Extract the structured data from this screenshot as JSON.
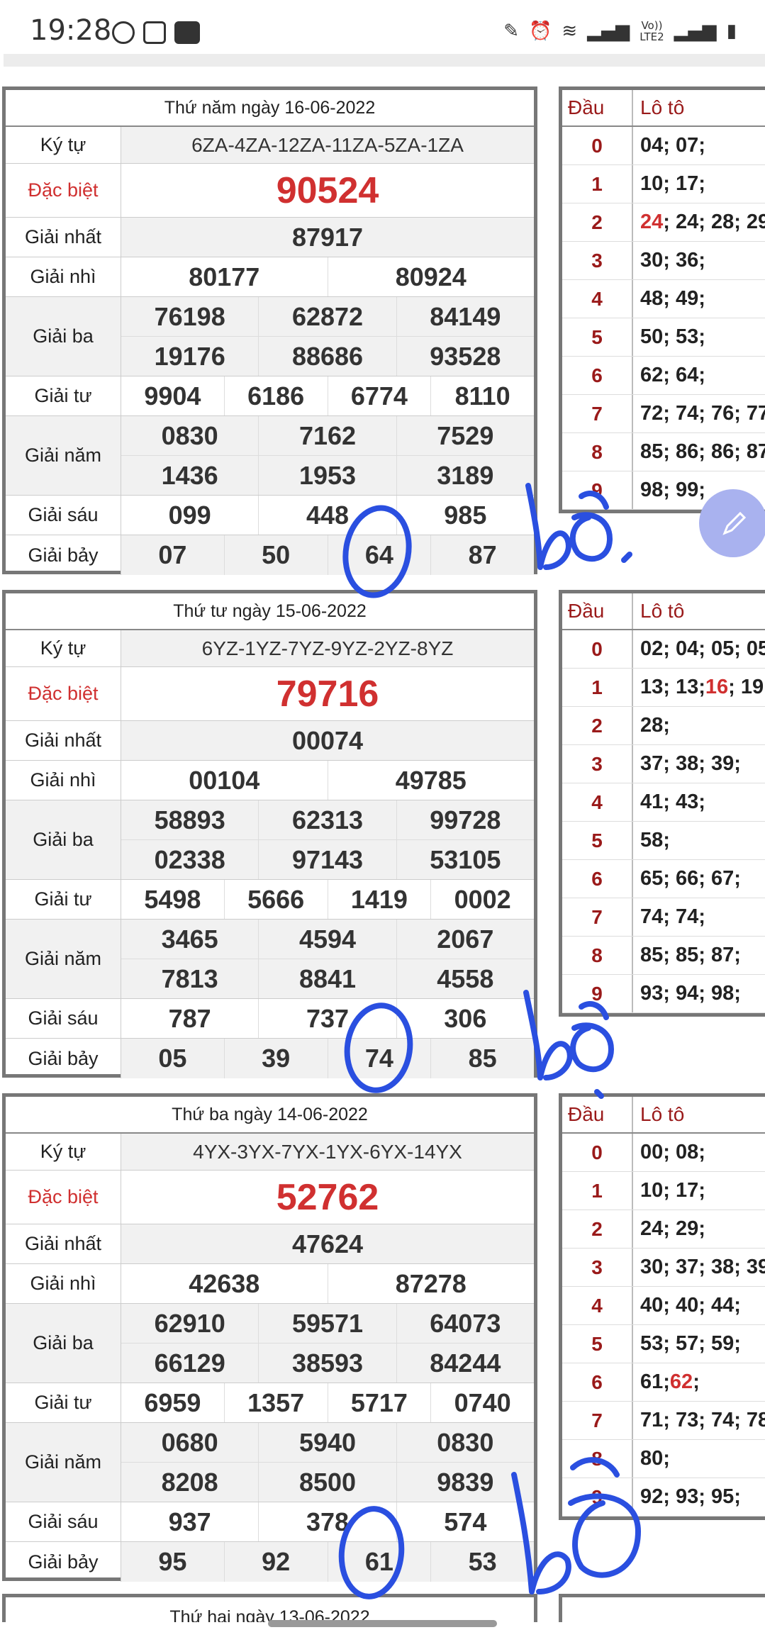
{
  "status_bar": {
    "time": "19:28",
    "network_label_top": "Vo))",
    "network_label_bottom": "LTE2"
  },
  "days": [
    {
      "title": "Thứ năm ngày 16-06-2022",
      "labels": {
        "code": "Ký tự",
        "special": "Đặc biệt",
        "first": "Giải nhất",
        "second": "Giải nhì",
        "third": "Giải ba",
        "fourth": "Giải tư",
        "fifth": "Giải năm",
        "sixth": "Giải sáu",
        "seventh": "Giải bảy"
      },
      "code": "6ZA-4ZA-12ZA-11ZA-5ZA-1ZA",
      "special": "90524",
      "first": "87917",
      "second": [
        "80177",
        "80924"
      ],
      "third": [
        "76198",
        "62872",
        "84149",
        "19176",
        "88686",
        "93528"
      ],
      "fourth": [
        "9904",
        "6186",
        "6774",
        "8110"
      ],
      "fifth": [
        "0830",
        "7162",
        "7529",
        "1436",
        "1953",
        "3189"
      ],
      "sixth": [
        "099",
        "448",
        "985"
      ],
      "seventh": [
        "07",
        "50",
        "64",
        "87"
      ],
      "loto_header": {
        "dau": "Đầu",
        "loto": "Lô tô"
      },
      "loto": [
        {
          "d": "0",
          "v": "04; 07;"
        },
        {
          "d": "1",
          "v": "10; 17;"
        },
        {
          "d": "2",
          "hi": "24",
          "v": "; 24; 28; 29"
        },
        {
          "d": "3",
          "v": "30; 36;"
        },
        {
          "d": "4",
          "v": "48; 49;"
        },
        {
          "d": "5",
          "v": "50; 53;"
        },
        {
          "d": "6",
          "v": "62; 64;"
        },
        {
          "d": "7",
          "v": "72; 74; 76; 77"
        },
        {
          "d": "8",
          "v": "85; 86; 86; 87"
        },
        {
          "d": "9",
          "v": "98; 99;"
        }
      ]
    },
    {
      "title": "Thứ tư ngày 15-06-2022",
      "labels": {
        "code": "Ký tự",
        "special": "Đặc biệt",
        "first": "Giải nhất",
        "second": "Giải nhì",
        "third": "Giải ba",
        "fourth": "Giải tư",
        "fifth": "Giải năm",
        "sixth": "Giải sáu",
        "seventh": "Giải bảy"
      },
      "code": "6YZ-1YZ-7YZ-9YZ-2YZ-8YZ",
      "special": "79716",
      "first": "00074",
      "second": [
        "00104",
        "49785"
      ],
      "third": [
        "58893",
        "62313",
        "99728",
        "02338",
        "97143",
        "53105"
      ],
      "fourth": [
        "5498",
        "5666",
        "1419",
        "0002"
      ],
      "fifth": [
        "3465",
        "4594",
        "2067",
        "7813",
        "8841",
        "4558"
      ],
      "sixth": [
        "787",
        "737",
        "306"
      ],
      "seventh": [
        "05",
        "39",
        "74",
        "85"
      ],
      "loto_header": {
        "dau": "Đầu",
        "loto": "Lô tô"
      },
      "loto": [
        {
          "d": "0",
          "v": "02; 04; 05; 05"
        },
        {
          "d": "1",
          "v": "13; 13; ",
          "hi": "16",
          "tail": "; 19"
        },
        {
          "d": "2",
          "v": "28;"
        },
        {
          "d": "3",
          "v": "37; 38; 39;"
        },
        {
          "d": "4",
          "v": "41; 43;"
        },
        {
          "d": "5",
          "v": "58;"
        },
        {
          "d": "6",
          "v": "65; 66; 67;"
        },
        {
          "d": "7",
          "v": "74; 74;"
        },
        {
          "d": "8",
          "v": "85; 85; 87;"
        },
        {
          "d": "9",
          "v": "93; 94; 98;"
        }
      ]
    },
    {
      "title": "Thứ ba ngày 14-06-2022",
      "labels": {
        "code": "Ký tự",
        "special": "Đặc biệt",
        "first": "Giải nhất",
        "second": "Giải nhì",
        "third": "Giải ba",
        "fourth": "Giải tư",
        "fifth": "Giải năm",
        "sixth": "Giải sáu",
        "seventh": "Giải bảy"
      },
      "code": "4YX-3YX-7YX-1YX-6YX-14YX",
      "special": "52762",
      "first": "47624",
      "second": [
        "42638",
        "87278"
      ],
      "third": [
        "62910",
        "59571",
        "64073",
        "66129",
        "38593",
        "84244"
      ],
      "fourth": [
        "6959",
        "1357",
        "5717",
        "0740"
      ],
      "fifth": [
        "0680",
        "5940",
        "0830",
        "8208",
        "8500",
        "9839"
      ],
      "sixth": [
        "937",
        "378",
        "574"
      ],
      "seventh": [
        "95",
        "92",
        "61",
        "53"
      ],
      "loto_header": {
        "dau": "Đầu",
        "loto": "Lô tô"
      },
      "loto": [
        {
          "d": "0",
          "v": "00; 08;"
        },
        {
          "d": "1",
          "v": "10; 17;"
        },
        {
          "d": "2",
          "v": "24; 29;"
        },
        {
          "d": "3",
          "v": "30; 37; 38; 39"
        },
        {
          "d": "4",
          "v": "40; 40; 44;"
        },
        {
          "d": "5",
          "v": "53; 57; 59;"
        },
        {
          "d": "6",
          "v": "61; ",
          "hi": "62",
          "tail": ";"
        },
        {
          "d": "7",
          "v": "71; 73; 74; 78"
        },
        {
          "d": "8",
          "v": "80;"
        },
        {
          "d": "9",
          "v": "92; 93; 95;"
        }
      ]
    }
  ],
  "next_day_title": "Thứ hai ngày 13-06-2022",
  "handwriting": {
    "word": "bố",
    "digit": "0",
    "color": "#2a4fe0"
  }
}
